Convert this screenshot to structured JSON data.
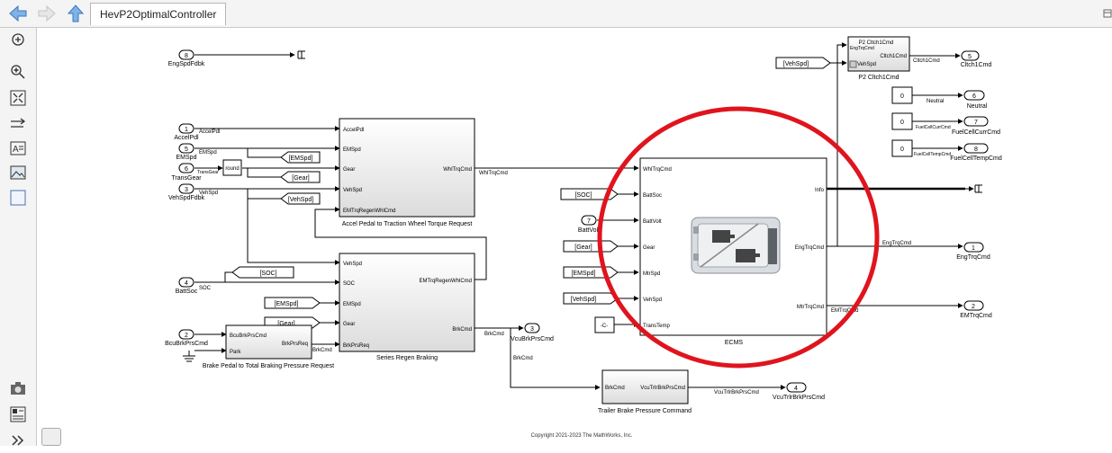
{
  "toolbar": {
    "tab_label": "HevP2OptimalController"
  },
  "left_toolbar": {
    "icons": [
      "zoom-fit-icon",
      "zoom-in-icon",
      "fit-view-icon",
      "arrow-lines-icon",
      "annotation-icon",
      "image-icon",
      "rectangle-icon",
      "camera-icon",
      "property-inspector-icon",
      "expand-icon"
    ]
  },
  "diagram": {
    "copyright": "Copyright 2021-2023 The MathWorks, Inc.",
    "inports": {
      "accelpdl": {
        "num": "1",
        "label": "AccelPdl",
        "signal": "AccelPdl"
      },
      "emspd": {
        "num": "5",
        "label": "EMSpd",
        "signal": "EMSpd"
      },
      "transgear": {
        "num": "6",
        "label": "TransGear",
        "signal": "TransGear"
      },
      "vehspd": {
        "num": "3",
        "label": "VehSpdFdbk",
        "signal": "VehSpd"
      },
      "battsoc": {
        "num": "4",
        "label": "BattSoc",
        "signal": "SOC"
      },
      "bcubrk": {
        "num": "2",
        "label": "BcuBrkPrsCmd"
      },
      "engspd": {
        "num": "8",
        "label": "EngSpdFdbk"
      },
      "battvolt": {
        "num": "7",
        "label": "BattVolt"
      }
    },
    "outports": {
      "clutch": {
        "num": "5",
        "label": "Cltch1Cmd",
        "signal": "Cltch1Cmd"
      },
      "neutral": {
        "num": "6",
        "label": "Neutral",
        "signal": "Neutral"
      },
      "fuelcum": {
        "num": "7",
        "label": "FuelCellCurrCmd",
        "signal": "FuelCellCurrCmd"
      },
      "fueltemp": {
        "num": "8",
        "label": "FuelCellTempCmd",
        "signal": "FuelCellTempCmd"
      },
      "engtrq": {
        "num": "1",
        "label": "EngTrqCmd",
        "signal": "EngTrqCmd"
      },
      "emtrq": {
        "num": "2",
        "label": "EMTrqCmd",
        "signal": "EMTrqCmd"
      },
      "vcubrk": {
        "num": "3",
        "label": "VcuBrkPrsCmd"
      },
      "trlr": {
        "num": "4",
        "label": "VcuTrlrBrkPrsCmd"
      }
    },
    "round_label": "round",
    "tags": {
      "emspd": "[EMSpd]",
      "gear": "[Gear]",
      "vehspd": "[VehSpd]",
      "soc": "[SOC]"
    },
    "const_c": "-C-",
    "const_zero": "0",
    "accel_block": {
      "name": "Accel Pedal to Traction Wheel Torque Request",
      "in_ports": [
        "AccelPdl",
        "EMSpd",
        "Gear",
        "VehSpd",
        "EMTrqRegenWhlCmd"
      ],
      "out_port": "WhlTrqCmd",
      "out_signal": "WhlTrqCmd"
    },
    "regen_block": {
      "name": "Series Regen Braking",
      "in_ports": [
        "VehSpd",
        "SOC",
        "EMSpd",
        "Gear",
        "BrkPrsReq"
      ],
      "out_ports": [
        "EMTrqRegenWhlCmd",
        "BrkCmd"
      ],
      "out_signal": "BrkCmd"
    },
    "brake_block": {
      "name": "Brake Pedal to Total Braking Pressure Request",
      "in_ports": [
        "BcuBrkPrsCmd",
        "Park"
      ],
      "out_port": "BrkPrsReq",
      "out_signal": "BrkCmd"
    },
    "trailer_block": {
      "name": "Trailer Brake Pressure Command",
      "in_port": "BrkCmd",
      "out_port": "VcuTrlrBrkPrsCmd",
      "out_signal": "VcuTrlrBrkPrsCmd",
      "branch_signal": "BrkCmd"
    },
    "clutch_block": {
      "name": "P2 Cltch1Cmd",
      "in_ports": [
        "EngTrqCmd",
        "VehSpd"
      ],
      "out_port": "Cltch1Cmd"
    },
    "ecms_block": {
      "name": "ECMS",
      "in_ports": [
        "WhlTrqCmd",
        "BattSoc",
        "BattVolt",
        "Gear",
        "MtrSpd",
        "VehSpd",
        "TransTemp"
      ],
      "out_ports": [
        "Info",
        "EngTrqCmd",
        "MtrTrqCmd"
      ]
    }
  },
  "highlight": {
    "color": "#e0141e",
    "shape": "ellipse"
  }
}
